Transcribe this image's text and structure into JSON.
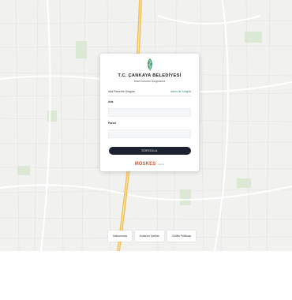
{
  "card": {
    "title": "T.C. ÇANKAYA BELEDİYESİ",
    "subtitle": "İmar Durumu Sorgulama",
    "tabs": [
      {
        "label": "Ada Parsel ile Sorgula",
        "active": false
      },
      {
        "label": "Adres ile Sorgula",
        "active": true
      }
    ],
    "fields": {
      "first_label": "Ada",
      "first_value": "",
      "second_label": "Parsel",
      "second_value": ""
    },
    "submit_label": "SORGULA",
    "brand_name": "MOSKES",
    "brand_suffix": "Harita"
  },
  "footer": {
    "links": [
      "Hakkımızda",
      "Kullanım Şartları",
      "Gizlilik Politikası"
    ]
  },
  "colors": {
    "accent": "#2b8a6a",
    "button": "#1d2230",
    "brand": "#d3562a",
    "map_road": "#f2c15c",
    "map_bg": "#f1f1ef"
  }
}
